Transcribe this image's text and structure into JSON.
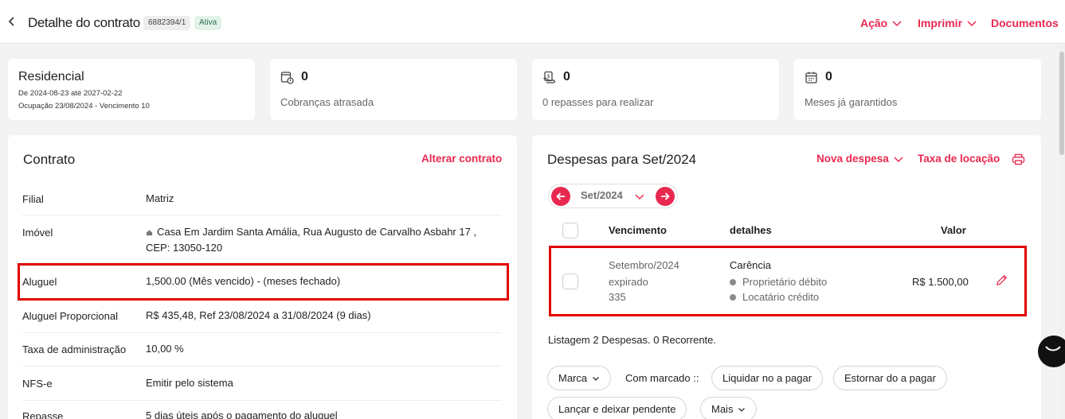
{
  "header": {
    "title": "Detalhe do contrato",
    "contract_number": "6882394/1",
    "status": "Ativa",
    "actions": {
      "acao": "Ação",
      "imprimir": "Imprimir",
      "documentos": "Documentos"
    }
  },
  "summary": {
    "residencial": {
      "title": "Residencial",
      "period": "De 2024-08-23 até 2027-02-22",
      "occupation": "Ocupação 23/08/2024 - Vencimento 10"
    },
    "cobrancas": {
      "count": "0",
      "label": "Cobranças atrasada"
    },
    "repasses": {
      "count": "0",
      "label": "0 repasses para realizar"
    },
    "meses": {
      "count": "0",
      "label": "Meses já garantidos"
    }
  },
  "contrato": {
    "title": "Contrato",
    "alterar": "Alterar contrato",
    "rows": [
      {
        "label": "Filial",
        "value": "Matriz"
      },
      {
        "label": "Imóvel",
        "value": "Casa Em Jardim Santa Amália, Rua Augusto de Carvalho Asbahr 17 , CEP: 13050-120"
      },
      {
        "label": "Aluguel",
        "value": "1,500.00 (Mês vencido) - (meses fechado)"
      },
      {
        "label": "Aluguel Proporcional",
        "value": "R$ 435,48, Ref 23/08/2024 a 31/08/2024 (9 dias)"
      },
      {
        "label": "Taxa de administração",
        "value": "10,00 %"
      },
      {
        "label": "NFS-e",
        "value": "Emitir pelo sistema"
      },
      {
        "label": "Repasse",
        "value": "5 dias úteis após o pagamento do aluguel"
      }
    ]
  },
  "despesas": {
    "title": "Despesas para Set/2024",
    "nova_despesa": "Nova despesa",
    "taxa_locacao": "Taxa de locação",
    "month": "Set/2024",
    "columns": {
      "vencimento": "Vencimento",
      "detalhes": "detalhes",
      "valor": "Valor"
    },
    "row": {
      "vencimento": "Setembro/2024",
      "status": "expirado",
      "number": "335",
      "tipo": "Carência",
      "detalhe1": "Proprietário débito",
      "detalhe2": "Locatário crédito",
      "valor": "R$ 1.500,00"
    },
    "listing": "Listagem 2 Despesas. 0 Recorrente.",
    "buttons": {
      "marca": "Marca",
      "com_marcado": "Com marcado ::",
      "liquidar": "Liquidar no a pagar",
      "estornar": "Estornar do a pagar",
      "lancar": "Lançar e deixar pendente",
      "mais": "Mais"
    }
  },
  "colors": {
    "accent": "#e8294f",
    "highlight": "#e00000",
    "status_bg": "#e2f3ea"
  },
  "icons": [
    "back-arrow-icon",
    "chevron-down-icon",
    "overdue-bill-icon",
    "transfer-hand-icon",
    "calendar-icon",
    "printer-icon",
    "arrow-left-icon",
    "arrow-right-icon",
    "home-icon",
    "pencil-icon",
    "chat-icon"
  ]
}
